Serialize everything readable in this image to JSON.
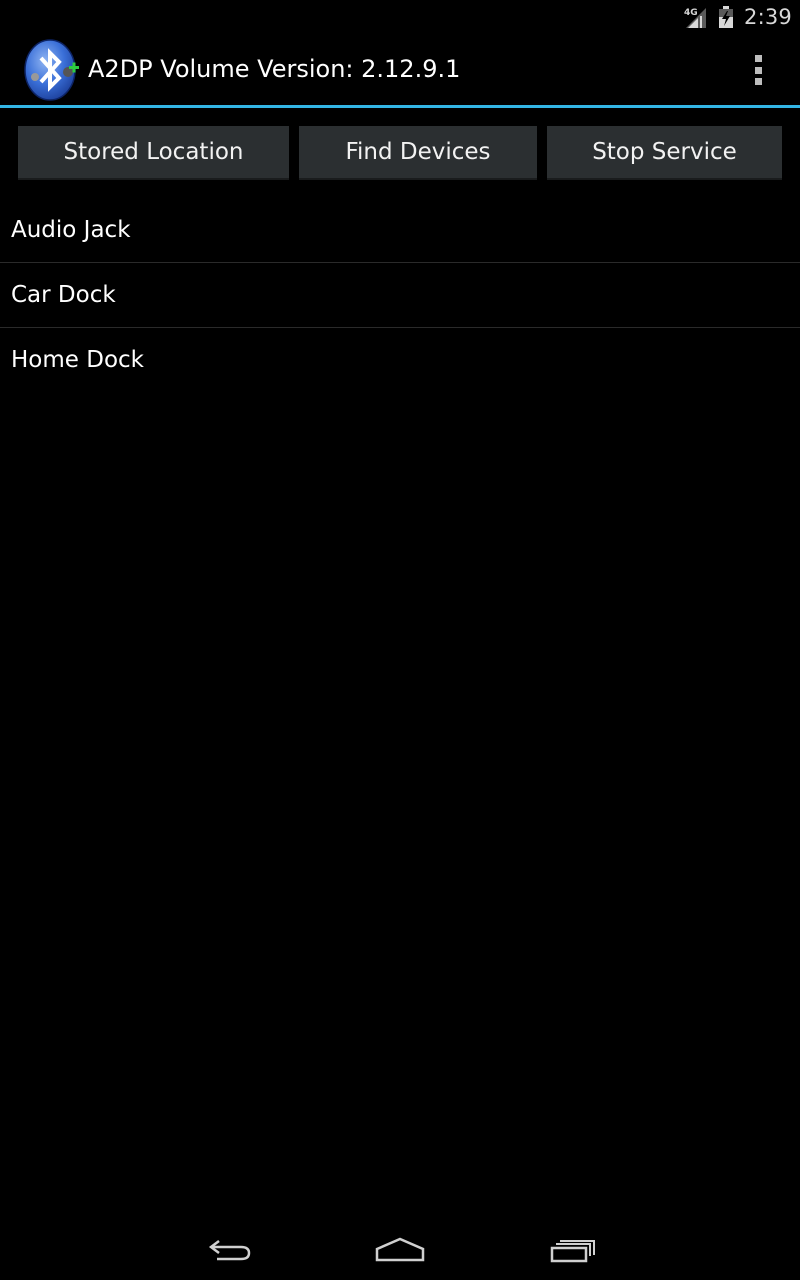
{
  "status_bar": {
    "time": "2:39",
    "network_label": "4G",
    "icons": [
      "signal-icon",
      "battery-icon"
    ]
  },
  "action_bar": {
    "title": "A2DP Volume Version: 2.12.9.1",
    "app_icon": "bluetooth-app-icon",
    "overflow_icon": "overflow-menu-icon"
  },
  "buttons": {
    "stored_location": "Stored Location",
    "find_devices": "Find Devices",
    "stop_service": "Stop Service"
  },
  "devices": [
    {
      "label": "Audio Jack"
    },
    {
      "label": "Car Dock"
    },
    {
      "label": "Home Dock"
    }
  ],
  "nav_bar": {
    "icons": [
      "back-icon",
      "home-icon",
      "recent-apps-icon"
    ]
  },
  "colors": {
    "accent": "#33b5e5",
    "button_bg": "#2b2f31",
    "background": "#000000"
  }
}
